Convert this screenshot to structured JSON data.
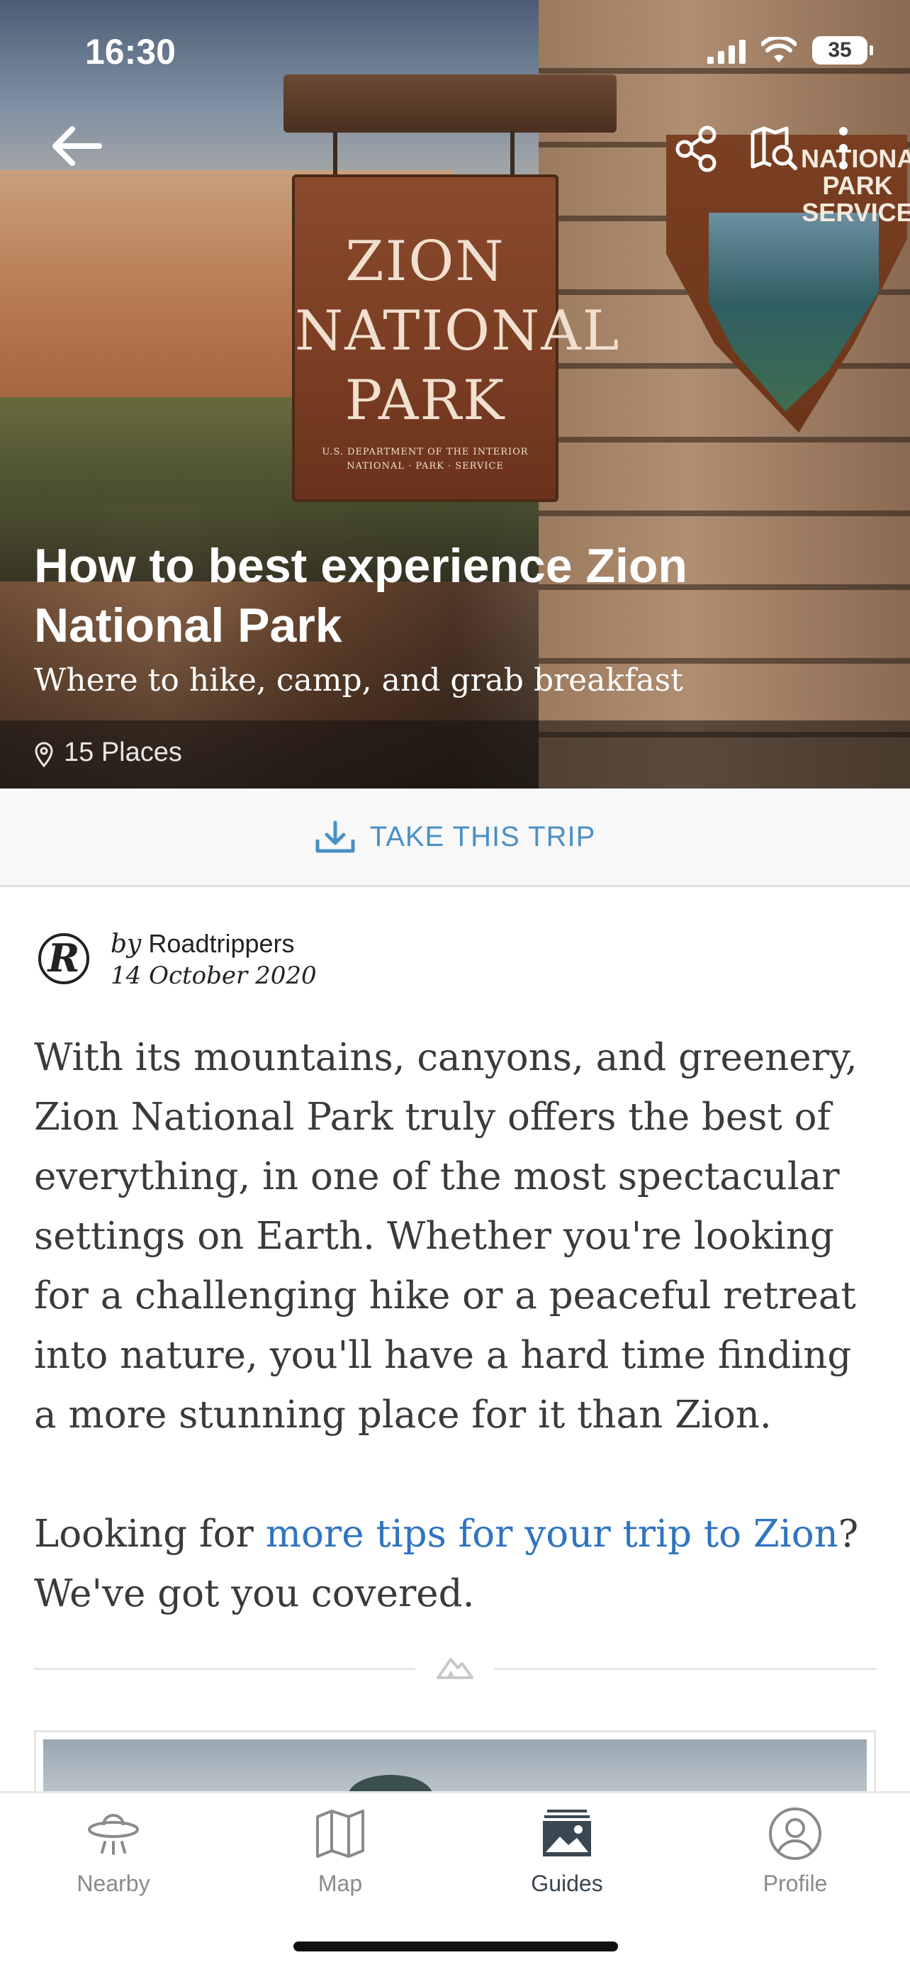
{
  "status_bar": {
    "time": "16:30",
    "battery": "35"
  },
  "hero": {
    "sign_lines": [
      "ZION",
      "NATIONAL",
      "PARK"
    ],
    "sign_small_lines": [
      "U.S. DEPARTMENT OF THE INTERIOR",
      "NATIONAL · PARK · SERVICE"
    ],
    "nps_text": [
      "NATIONAL",
      "PARK",
      "SERVICE"
    ],
    "title": "How to best experience Zion National Park",
    "subtitle": "Where to hike, camp, and grab breakfast",
    "places": "15 Places"
  },
  "actions": {
    "take_trip": "TAKE THIS TRIP"
  },
  "author": {
    "by": "by",
    "name": "Roadtrippers",
    "date": "14 October 2020",
    "logo_letter": "R"
  },
  "article": {
    "paragraph1": "With its mountains, canyons, and greenery, Zion National Park truly offers the best of everything, in one of the most spectacular settings on Earth. Whether you're looking for a challenging hike or a peaceful retreat into nature, you'll have a hard time finding a more stunning place for it than Zion.",
    "p2_before": "Looking for ",
    "p2_link": "more tips for your trip to Zion",
    "p2_after": "? We've got you covered."
  },
  "tabs": [
    {
      "label": "Nearby",
      "icon": "ufo-icon"
    },
    {
      "label": "Map",
      "icon": "map-icon"
    },
    {
      "label": "Guides",
      "icon": "guides-icon",
      "active": true
    },
    {
      "label": "Profile",
      "icon": "profile-icon"
    }
  ],
  "colors": {
    "accent": "#4a90c4",
    "link": "#2f74c0",
    "text": "#3a3a3a"
  }
}
